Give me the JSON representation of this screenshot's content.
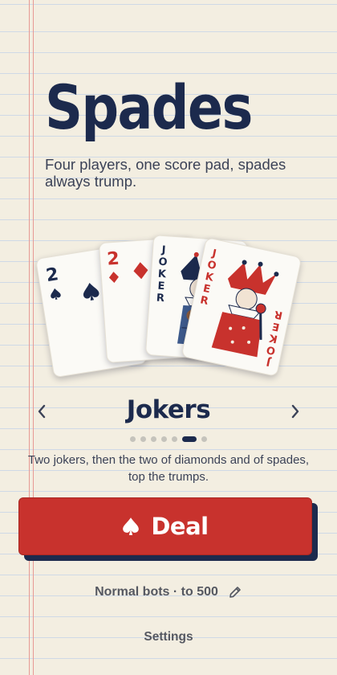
{
  "app": {
    "title": "Spades",
    "subtitle": "Four players, one score pad, spades always trump."
  },
  "hand": {
    "cards": [
      {
        "rank": "2",
        "suit": "spades"
      },
      {
        "rank": "2",
        "suit": "diamonds"
      },
      {
        "rank": "JOKER",
        "suit": "joker-blue"
      },
      {
        "rank": "JOKER",
        "suit": "joker-red"
      }
    ]
  },
  "carousel": {
    "mode_title": "Jokers",
    "description": "Two jokers, then the two of diamonds and of spades, top the trumps.",
    "page_count": 7,
    "active_index": 5
  },
  "actions": {
    "deal_label": "Deal",
    "settings_summary": "Normal bots · to 500",
    "settings_label": "Settings"
  },
  "colors": {
    "navy": "#1c2a4d",
    "red": "#c8322d",
    "paper": "#f3eee1"
  }
}
